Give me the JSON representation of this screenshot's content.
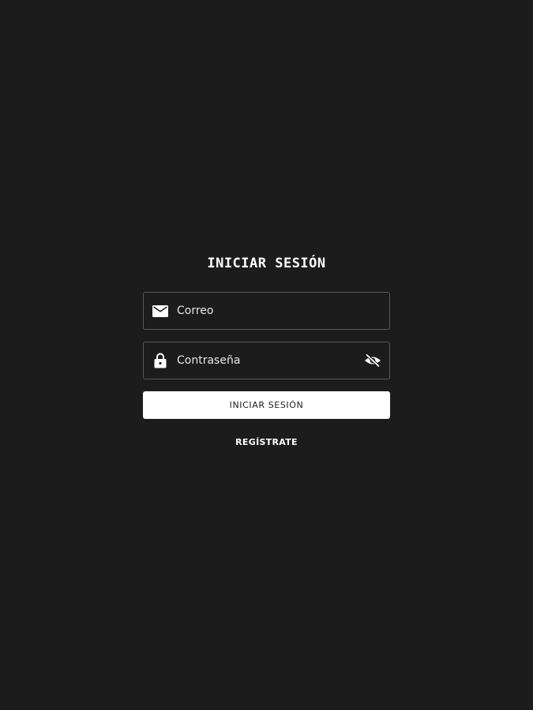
{
  "login": {
    "title": "INICIAR SESIÓN",
    "email": {
      "placeholder": "Correo",
      "value": "",
      "icon": "mail-icon"
    },
    "password": {
      "placeholder": "Contraseña",
      "value": "",
      "icon": "lock-icon",
      "toggle_icon": "eye-off-icon"
    },
    "submit_label": "INICIAR SESIÓN",
    "register_label": "REGÍSTRATE"
  },
  "colors": {
    "background": "#1c1c1c",
    "field_border": "#5a5a5a",
    "button_background": "#ffffff",
    "text": "#ffffff"
  }
}
